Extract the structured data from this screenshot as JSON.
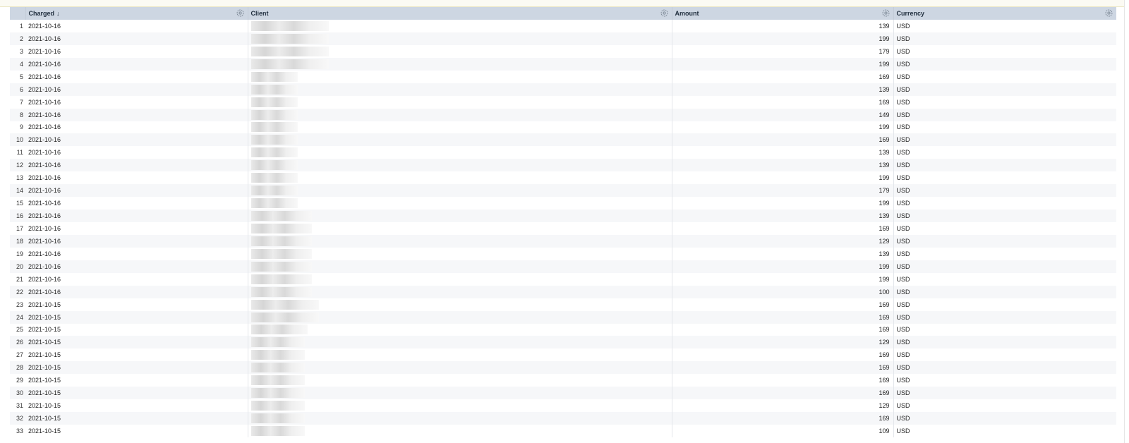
{
  "columns": {
    "charged": "Charged",
    "charged_sort": "↓",
    "client": "Client",
    "amount": "Amount",
    "currency": "Currency"
  },
  "rows": [
    {
      "n": "1",
      "charged": "2021-10-16",
      "amount": "139",
      "currency": "USD",
      "client_blur": 0.55
    },
    {
      "n": "2",
      "charged": "2021-10-16",
      "amount": "199",
      "currency": "USD",
      "client_blur": 0.55
    },
    {
      "n": "3",
      "charged": "2021-10-16",
      "amount": "179",
      "currency": "USD",
      "client_blur": 0.55
    },
    {
      "n": "4",
      "charged": "2021-10-16",
      "amount": "199",
      "currency": "USD",
      "client_blur": 0.55
    },
    {
      "n": "5",
      "charged": "2021-10-16",
      "amount": "169",
      "currency": "USD",
      "client_blur": 0.33
    },
    {
      "n": "6",
      "charged": "2021-10-16",
      "amount": "139",
      "currency": "USD",
      "client_blur": 0.33
    },
    {
      "n": "7",
      "charged": "2021-10-16",
      "amount": "169",
      "currency": "USD",
      "client_blur": 0.33
    },
    {
      "n": "8",
      "charged": "2021-10-16",
      "amount": "149",
      "currency": "USD",
      "client_blur": 0.33
    },
    {
      "n": "9",
      "charged": "2021-10-16",
      "amount": "199",
      "currency": "USD",
      "client_blur": 0.33
    },
    {
      "n": "10",
      "charged": "2021-10-16",
      "amount": "169",
      "currency": "USD",
      "client_blur": 0.33
    },
    {
      "n": "11",
      "charged": "2021-10-16",
      "amount": "139",
      "currency": "USD",
      "client_blur": 0.33
    },
    {
      "n": "12",
      "charged": "2021-10-16",
      "amount": "139",
      "currency": "USD",
      "client_blur": 0.33
    },
    {
      "n": "13",
      "charged": "2021-10-16",
      "amount": "199",
      "currency": "USD",
      "client_blur": 0.33
    },
    {
      "n": "14",
      "charged": "2021-10-16",
      "amount": "179",
      "currency": "USD",
      "client_blur": 0.33
    },
    {
      "n": "15",
      "charged": "2021-10-16",
      "amount": "199",
      "currency": "USD",
      "client_blur": 0.33
    },
    {
      "n": "16",
      "charged": "2021-10-16",
      "amount": "139",
      "currency": "USD",
      "client_blur": 0.43
    },
    {
      "n": "17",
      "charged": "2021-10-16",
      "amount": "169",
      "currency": "USD",
      "client_blur": 0.43
    },
    {
      "n": "18",
      "charged": "2021-10-16",
      "amount": "129",
      "currency": "USD",
      "client_blur": 0.43
    },
    {
      "n": "19",
      "charged": "2021-10-16",
      "amount": "139",
      "currency": "USD",
      "client_blur": 0.43
    },
    {
      "n": "20",
      "charged": "2021-10-16",
      "amount": "199",
      "currency": "USD",
      "client_blur": 0.43
    },
    {
      "n": "21",
      "charged": "2021-10-16",
      "amount": "199",
      "currency": "USD",
      "client_blur": 0.43
    },
    {
      "n": "22",
      "charged": "2021-10-16",
      "amount": "100",
      "currency": "USD",
      "client_blur": 0.43
    },
    {
      "n": "23",
      "charged": "2021-10-15",
      "amount": "169",
      "currency": "USD",
      "client_blur": 0.48
    },
    {
      "n": "24",
      "charged": "2021-10-15",
      "amount": "169",
      "currency": "USD",
      "client_blur": 0.48
    },
    {
      "n": "25",
      "charged": "2021-10-15",
      "amount": "169",
      "currency": "USD",
      "client_blur": 0.4
    },
    {
      "n": "26",
      "charged": "2021-10-15",
      "amount": "129",
      "currency": "USD",
      "client_blur": 0.38
    },
    {
      "n": "27",
      "charged": "2021-10-15",
      "amount": "169",
      "currency": "USD",
      "client_blur": 0.38
    },
    {
      "n": "28",
      "charged": "2021-10-15",
      "amount": "169",
      "currency": "USD",
      "client_blur": 0.38
    },
    {
      "n": "29",
      "charged": "2021-10-15",
      "amount": "169",
      "currency": "USD",
      "client_blur": 0.38
    },
    {
      "n": "30",
      "charged": "2021-10-15",
      "amount": "169",
      "currency": "USD",
      "client_blur": 0.38
    },
    {
      "n": "31",
      "charged": "2021-10-15",
      "amount": "129",
      "currency": "USD",
      "client_blur": 0.38
    },
    {
      "n": "32",
      "charged": "2021-10-15",
      "amount": "169",
      "currency": "USD",
      "client_blur": 0.38
    },
    {
      "n": "33",
      "charged": "2021-10-15",
      "amount": "109",
      "currency": "USD",
      "client_blur": 0.38
    }
  ],
  "colors": {
    "header_bg": "#cdd6e2",
    "stripe": "#f6f7f9"
  },
  "icons": {
    "column_settings": "gear-icon"
  }
}
